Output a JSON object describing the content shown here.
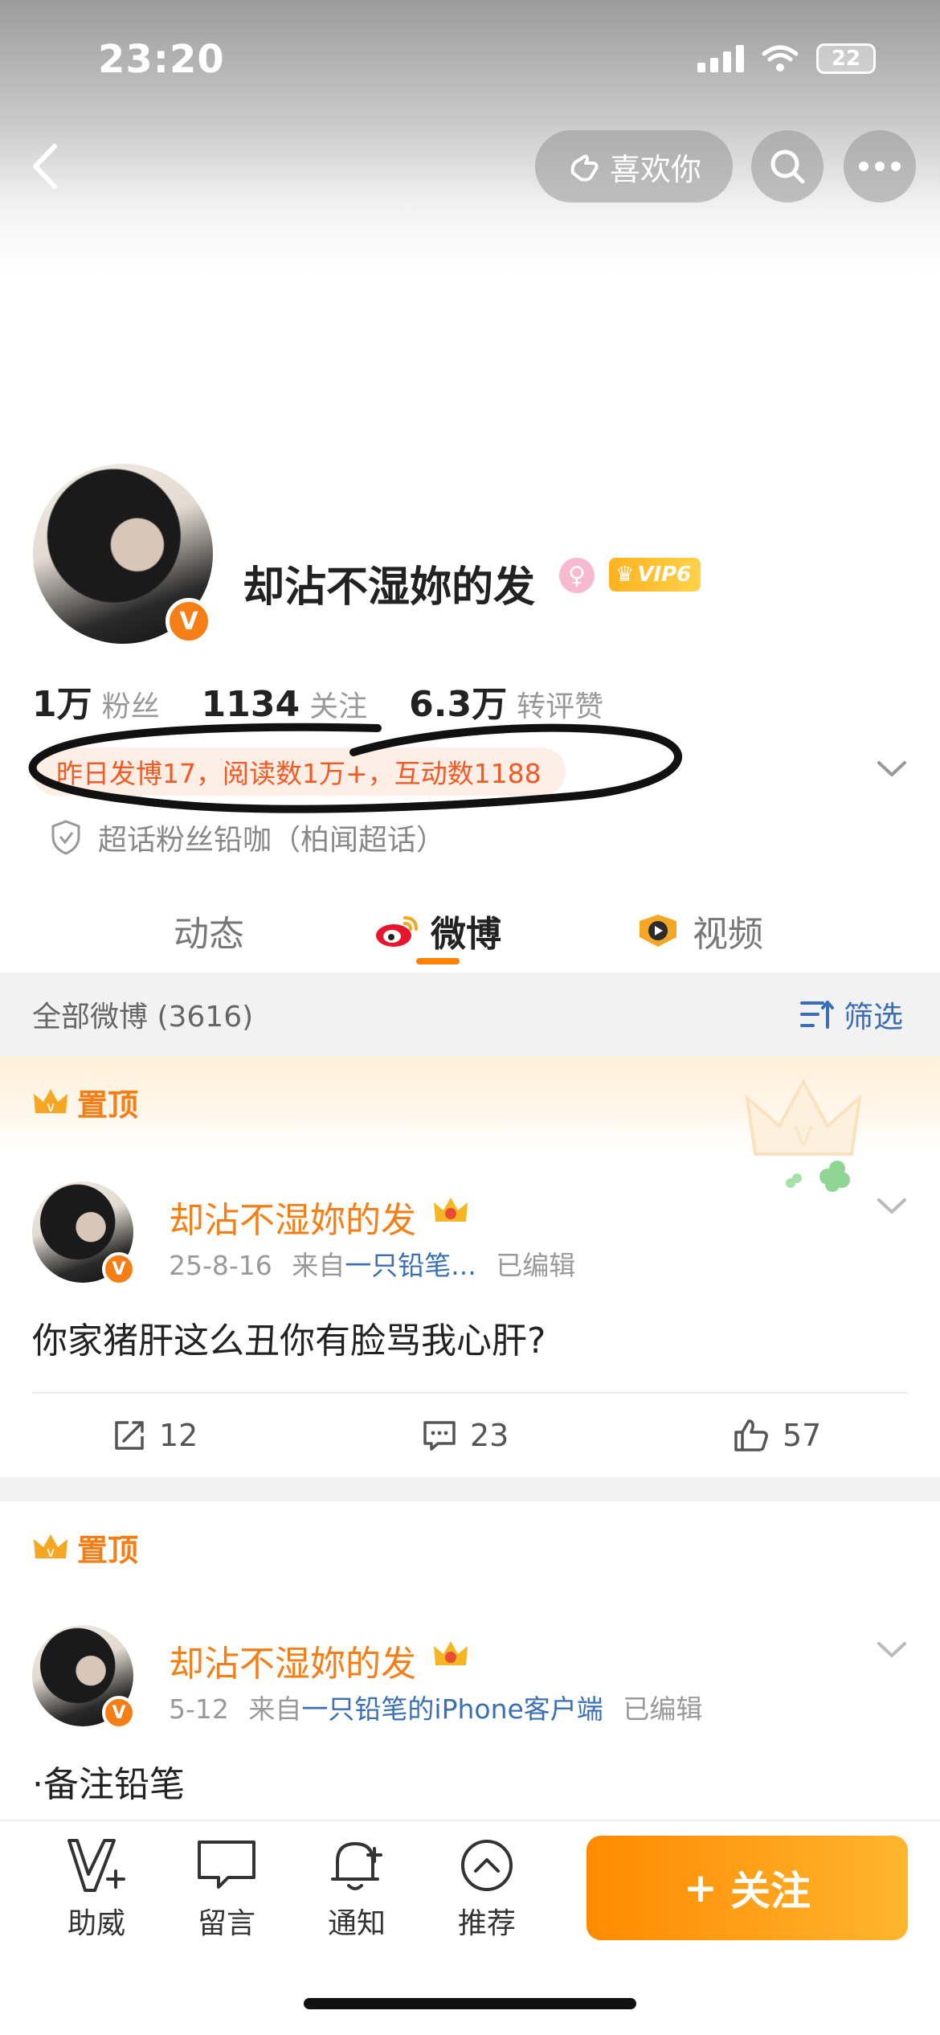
{
  "status_bar": {
    "time": "23:20",
    "battery": "22"
  },
  "header": {
    "like_label": "喜欢你"
  },
  "profile": {
    "name": "却沾不湿妳的发",
    "verified_mark": "V",
    "vip_label": "VIP6",
    "stats": [
      {
        "value": "1万",
        "label": "粉丝"
      },
      {
        "value": "1134",
        "label": "关注"
      },
      {
        "value": "6.3万",
        "label": "转评赞"
      }
    ],
    "daily_summary": "昨日发博17，阅读数1万+，互动数1188",
    "chaohua": "超话粉丝铅咖（柏闻超话）"
  },
  "tabs": [
    {
      "label": "动态"
    },
    {
      "label": "微博"
    },
    {
      "label": "视频"
    }
  ],
  "filter": {
    "count_label": "全部微博 (3616)",
    "filter_label": "筛选"
  },
  "posts": [
    {
      "pin_label": "置顶",
      "author": "却沾不湿妳的发",
      "date": "25-8-16",
      "from_label": "来自",
      "source": "一只铅笔...",
      "edited": "已编辑",
      "text": "你家猪肝这么丑你有脸骂我心肝?",
      "reposts": "12",
      "comments": "23",
      "likes": "57"
    },
    {
      "pin_label": "置顶",
      "author": "却沾不湿妳的发",
      "date": "5-12",
      "from_label": "来自",
      "source": "一只铅笔的iPhone客户端",
      "edited": "已编辑",
      "text": "·备注铅笔"
    }
  ],
  "bottom_bar": {
    "items": [
      {
        "label": "助威"
      },
      {
        "label": "留言"
      },
      {
        "label": "通知"
      },
      {
        "label": "推荐"
      }
    ],
    "follow_label": "关注"
  },
  "colors": {
    "accent": "#f57e16",
    "link": "#3a6fb5",
    "daily_text": "#f15a24"
  }
}
